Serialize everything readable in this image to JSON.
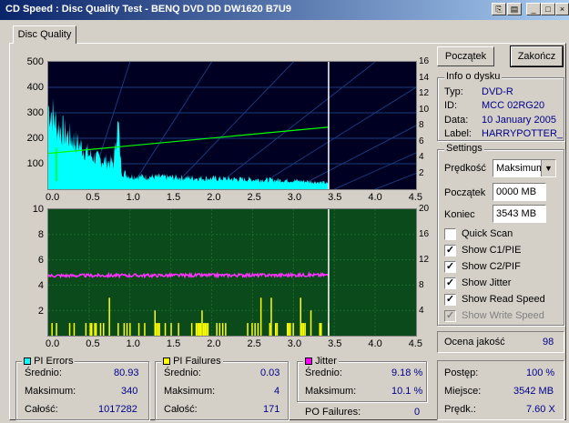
{
  "window": {
    "title": "CD Speed : Disc Quality Test - BENQ    DVD DD DW1620    B7U9"
  },
  "tabs": [
    {
      "label": "Disc Quality"
    }
  ],
  "chart_top": {
    "type": "area",
    "y_left_ticks": [
      "500",
      "400",
      "300",
      "200",
      "100"
    ],
    "y_right_ticks": [
      "16",
      "14",
      "12",
      "10",
      "8",
      "6",
      "4",
      "2"
    ],
    "x_ticks": [
      "0.0",
      "0.5",
      "1.0",
      "1.5",
      "2.0",
      "2.5",
      "3.0",
      "3.5",
      "4.0",
      "4.5"
    ]
  },
  "chart_bottom": {
    "type": "bar",
    "y_left_ticks": [
      "10",
      "8",
      "6",
      "4",
      "2"
    ],
    "y_right_ticks": [
      "20",
      "16",
      "12",
      "8",
      "4"
    ],
    "x_ticks": [
      "0.0",
      "0.5",
      "1.0",
      "1.5",
      "2.0",
      "2.5",
      "3.0",
      "3.5",
      "4.0",
      "4.5"
    ]
  },
  "chart_data": [
    {
      "type": "area",
      "x_range": [
        0,
        4.5
      ],
      "y_range": [
        0,
        500
      ],
      "y2_range": [
        0,
        16
      ],
      "series": [
        {
          "values_x": [
            0.0,
            0.05,
            0.1,
            0.2,
            0.3,
            0.4,
            0.5,
            0.6,
            0.7,
            0.8,
            0.85,
            0.9,
            1.0,
            1.5,
            2.0,
            2.5,
            3.0,
            3.4,
            3.43
          ],
          "values_y": [
            380,
            350,
            300,
            260,
            230,
            200,
            160,
            140,
            130,
            120,
            300,
            80,
            60,
            55,
            50,
            45,
            40,
            30,
            20
          ]
        },
        {
          "values_x": [
            0.0,
            3.43
          ],
          "values_y": [
            4.5,
            7.8
          ]
        }
      ]
    },
    {
      "type": "bar",
      "x_range": [
        0,
        4.5
      ],
      "y_range": [
        0,
        10
      ],
      "y2_range": [
        0,
        20
      ],
      "series": [
        {
          "values_x": [
            0.0,
            3.43
          ],
          "values_y": [
            9.5,
            9.6
          ]
        }
      ]
    }
  ],
  "buttons": {
    "start": "Początek",
    "end": "Zakończ"
  },
  "disc_info": {
    "title": "Info o dysku",
    "type_label": "Typ:",
    "type_value": "DVD-R",
    "id_label": "ID:",
    "id_value": "MCC 02RG20",
    "date_label": "Data:",
    "date_value": "10 January 2005",
    "label_label": "Label:",
    "label_value": "HARRYPOTTER_"
  },
  "settings": {
    "title": "Settings",
    "speed_label": "Prędkość",
    "speed_value": "Maksimum",
    "start_label": "Początek",
    "start_value": "0000 MB",
    "end_label": "Koniec",
    "end_value": "3543 MB",
    "options": [
      {
        "label": "Quick Scan",
        "checked": false,
        "disabled": false
      },
      {
        "label": "Show C1/PIE",
        "checked": true,
        "disabled": false
      },
      {
        "label": "Show C2/PIF",
        "checked": true,
        "disabled": false
      },
      {
        "label": "Show Jitter",
        "checked": true,
        "disabled": false
      },
      {
        "label": "Show Read Speed",
        "checked": true,
        "disabled": false
      },
      {
        "label": "Show Write Speed",
        "checked": true,
        "disabled": true
      }
    ]
  },
  "quality": {
    "label": "Ocena jakość",
    "value": "98"
  },
  "progress": {
    "progress_label": "Postęp:",
    "progress_value": "100 %",
    "location_label": "Miejsce:",
    "location_value": "3542 MB",
    "speed_label": "Prędk.:",
    "speed_value": "7.60 X"
  },
  "pi_errors": {
    "title": "PI Errors",
    "color": "#00ffff",
    "avg_label": "Średnio:",
    "avg_value": "80.93",
    "max_label": "Maksimum:",
    "max_value": "340",
    "total_label": "Całość:",
    "total_value": "1017282"
  },
  "pi_failures": {
    "title": "PI Failures",
    "color": "#ffff00",
    "avg_label": "Średnio:",
    "avg_value": "0.03",
    "max_label": "Maksimum:",
    "max_value": "4",
    "total_label": "Całość:",
    "total_value": "171"
  },
  "jitter": {
    "title": "Jitter",
    "color": "#ff00ff",
    "avg_label": "Średnio:",
    "avg_value": "9.18 %",
    "max_label": "Maksimum:",
    "max_value": "10.1 %"
  },
  "po_failures": {
    "label": "PO Failures:",
    "value": "0"
  }
}
